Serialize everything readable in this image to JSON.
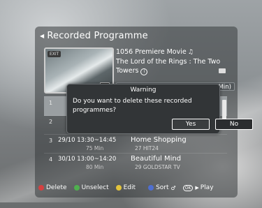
{
  "screen": {
    "title": "Recorded Programme",
    "title_arrow": "◀"
  },
  "preview": {
    "exit_label": "EXIT",
    "channel_line": "1056  Premiere Movie",
    "title_line1": "The Lord of the Rings : The Two",
    "title_line2": "Towers",
    "info_icon": "i",
    "strip_text": "Min)"
  },
  "list": {
    "rows": [
      {
        "num": "1",
        "date": "",
        "time": "",
        "duration": "",
        "programme": "",
        "channel": "",
        "selected": true
      },
      {
        "num": "2",
        "date": "",
        "time": "",
        "duration": "",
        "programme": "",
        "channel": "",
        "selected": false
      },
      {
        "num": "3",
        "date": "29/10",
        "time": "13:30~14:45",
        "duration": "75 Min",
        "programme": "Home Shopping",
        "channel": "27 HIT24",
        "selected": false
      },
      {
        "num": "4",
        "date": "30/10",
        "time": "13:00~14:20",
        "duration": "80 Min",
        "programme": "Beautiful Mind",
        "channel": "29 GOLDSTAR TV",
        "selected": false
      }
    ]
  },
  "dialog": {
    "title": "Warning",
    "message": "Do you want to delete these recorded programmes?",
    "yes_label": "Yes",
    "no_label": "No"
  },
  "footer": {
    "delete_label": "Delete",
    "unselect_label": "Unselect",
    "edit_label": "Edit",
    "sort_label": "Sort",
    "ok_label": "OK",
    "play_label": "Play"
  },
  "colors": {
    "red": "#d64040",
    "green": "#4fb04f",
    "yellow": "#e2c33c",
    "blue": "#4f6fd0",
    "selected_row": "#9a9fa2"
  }
}
